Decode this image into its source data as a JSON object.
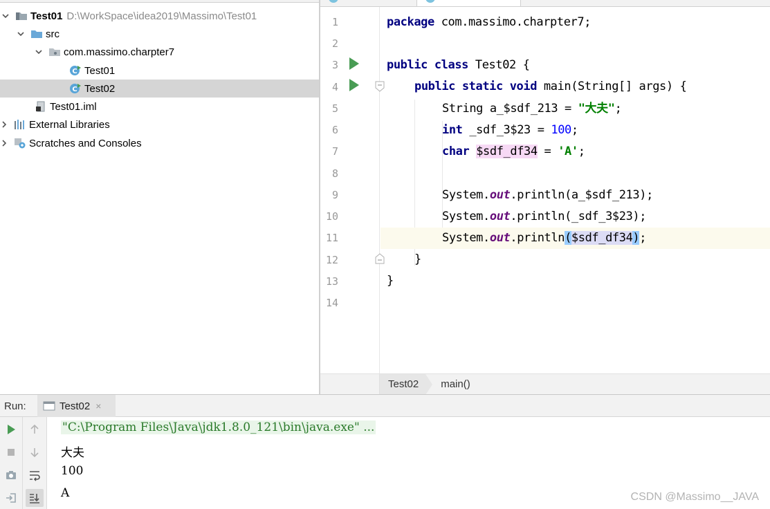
{
  "project_tree": {
    "root": {
      "name": "Test01",
      "path": "D:\\WorkSpace\\idea2019\\Massimo\\Test01"
    },
    "src": "src",
    "package": "com.massimo.charpter7",
    "class1": "Test01",
    "class2": "Test02",
    "iml": "Test01.iml",
    "ext_libs": "External Libraries",
    "scratches": "Scratches and Consoles"
  },
  "editor": {
    "line_numbers": [
      "1",
      "2",
      "3",
      "4",
      "5",
      "6",
      "7",
      "8",
      "9",
      "10",
      "11",
      "12",
      "13",
      "14"
    ],
    "code": {
      "l1_kw": "package",
      "l1_rest": " com.massimo.charpter7;",
      "l3_kw": "public class",
      "l3_rest": " Test02 {",
      "l4_kw": "public static void",
      "l4_rest": " main(String[] args) {",
      "l5_a": "String a_$sdf_213 = ",
      "l5_str": "\"大夫\"",
      "l5_end": ";",
      "l6_kw": "int",
      "l6_a": " _sdf_3$23 = ",
      "l6_num": "100",
      "l6_end": ";",
      "l7_kw": "char",
      "l7_var": "$sdf_df34",
      "l7_a": " = ",
      "l7_chr": "'A'",
      "l7_end": ";",
      "sys": "System.",
      "out": "out",
      "println": ".println",
      "l9_args": "(a_$sdf_213);",
      "l10_args": "(_sdf_3$23);",
      "l11_open": "(",
      "l11_var": "$sdf_df34",
      "l11_close": ")",
      "l11_end": ";",
      "l12": "}",
      "l13": "}"
    },
    "breadcrumbs": [
      "Test02",
      "main()"
    ]
  },
  "run_panel": {
    "label": "Run:",
    "tab_title": "Test02",
    "tab_close": "×",
    "console": [
      "\"C:\\Program Files\\Java\\jdk1.8.0_121\\bin\\java.exe\" ...",
      "大夫",
      "100",
      "A"
    ]
  },
  "watermark": "CSDN @Massimo__JAVA"
}
